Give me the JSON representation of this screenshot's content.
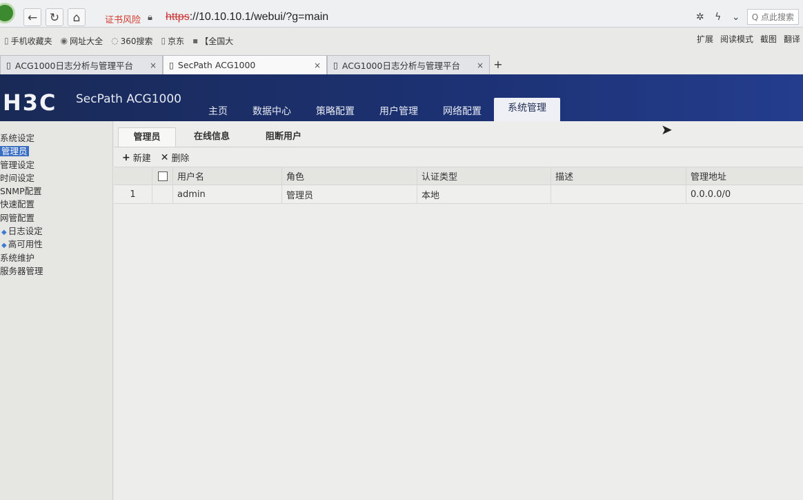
{
  "browser": {
    "cert_warning": "证书风险",
    "url_scheme": "https",
    "url_rest": "://10.10.10.1/webui/?g=main",
    "search_placeholder": "点此搜索",
    "bookmarks": [
      "手机收藏夹",
      "网址大全",
      "360搜索",
      "京东",
      "【全国大"
    ],
    "bookmarks_right": [
      "扩展",
      "阅读模式",
      "截图",
      "翻译"
    ],
    "tabs": [
      {
        "title": "ACG1000日志分析与管理平台",
        "active": false
      },
      {
        "title": "SecPath ACG1000",
        "active": true
      },
      {
        "title": "ACG1000日志分析与管理平台",
        "active": false
      }
    ],
    "close_symbol": "×",
    "new_tab_symbol": "+"
  },
  "app": {
    "brand": "H3C",
    "product": "SecPath ACG1000",
    "menu": [
      "主页",
      "数据中心",
      "策略配置",
      "用户管理",
      "网络配置",
      "系统管理"
    ],
    "active_menu": "系统管理"
  },
  "sidebar": {
    "items": [
      {
        "label": "系统设定",
        "selected": false,
        "sub": false
      },
      {
        "label": "管理员",
        "selected": true,
        "sub": false
      },
      {
        "label": "管理设定",
        "selected": false,
        "sub": false
      },
      {
        "label": "时间设定",
        "selected": false,
        "sub": false
      },
      {
        "label": "SNMP配置",
        "selected": false,
        "sub": false
      },
      {
        "label": "快速配置",
        "selected": false,
        "sub": false
      },
      {
        "label": "网管配置",
        "selected": false,
        "sub": false
      },
      {
        "label": "日志设定",
        "selected": false,
        "sub": true
      },
      {
        "label": "高可用性",
        "selected": false,
        "sub": true
      },
      {
        "label": "系统维护",
        "selected": false,
        "sub": false
      },
      {
        "label": "服务器管理",
        "selected": false,
        "sub": false
      }
    ]
  },
  "main": {
    "sub_tabs": [
      "管理员",
      "在线信息",
      "阻断用户"
    ],
    "toolbar": {
      "new_label": "新建",
      "delete_label": "删除"
    },
    "table": {
      "columns": [
        "用户名",
        "角色",
        "认证类型",
        "描述",
        "管理地址"
      ],
      "rows": [
        {
          "num": "1",
          "username": "admin",
          "role": "管理员",
          "auth": "本地",
          "desc": "",
          "addr": "0.0.0.0/0"
        }
      ]
    }
  }
}
